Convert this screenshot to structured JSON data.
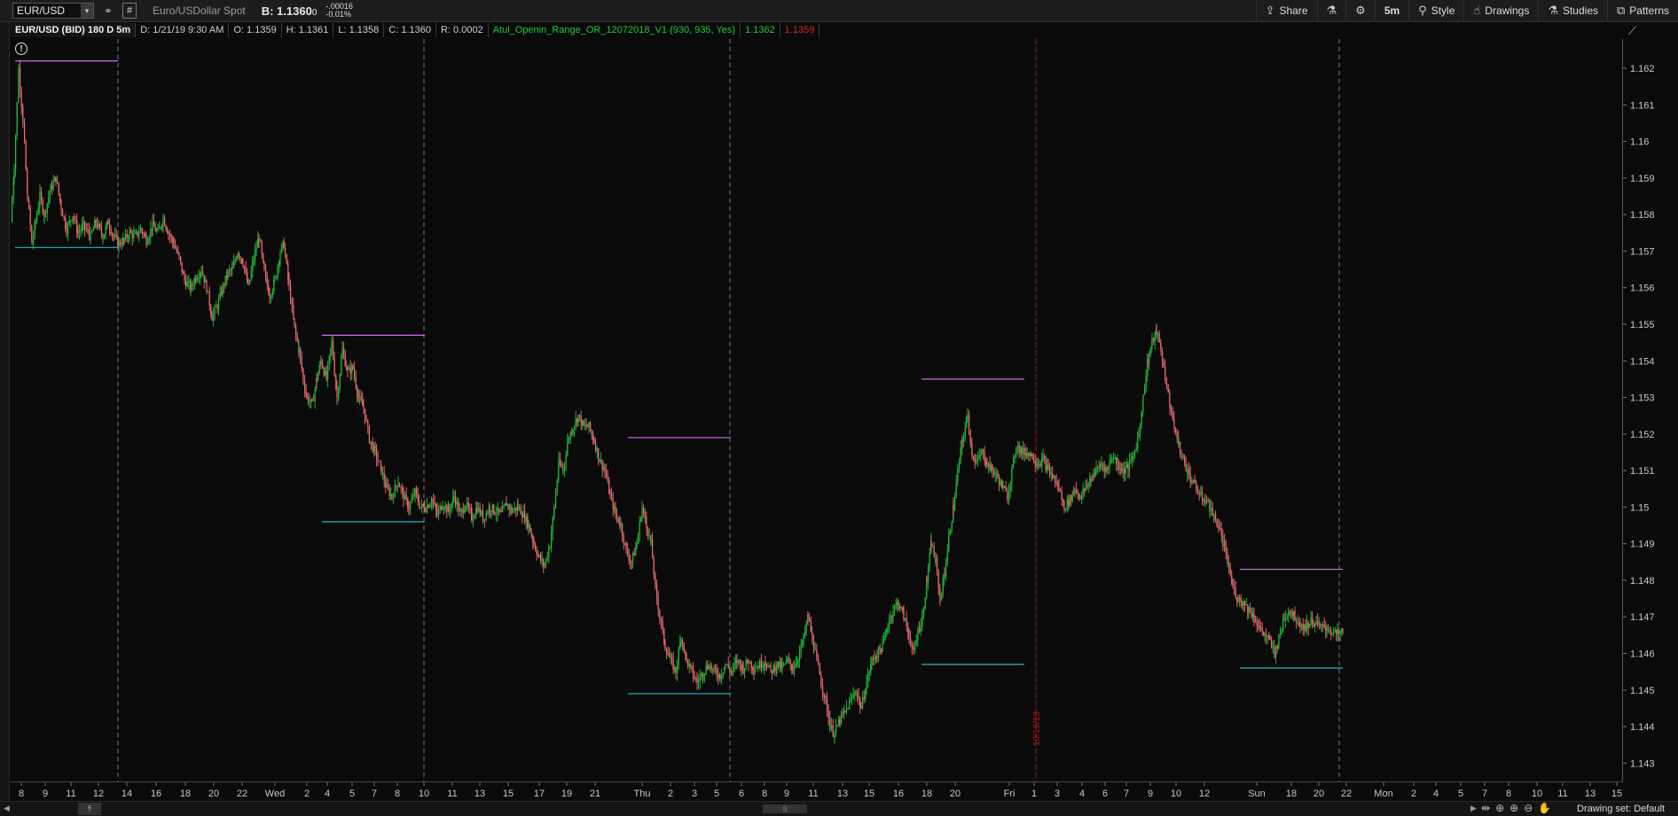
{
  "toolbar": {
    "symbol": "EUR/USD",
    "description": "Euro/USDollar Spot",
    "bid_label": "B: 1.1360",
    "bid_small": "0",
    "change_abs": "-.00016",
    "change_pct": "-0.01%",
    "share": "Share",
    "timeframe": "5m",
    "style": "Style",
    "drawings": "Drawings",
    "studies": "Studies",
    "patterns": "Patterns"
  },
  "info": {
    "title": "EUR/USD (BID) 180 D 5m",
    "date": "D: 1/21/19 9:30 AM",
    "open": "O: 1.1359",
    "high": "H: 1.1361",
    "low": "L: 1.1358",
    "close": "C: 1.1360",
    "range": "R: 0.0002",
    "study": "Atul_Openin_Range_OR_12072018_V1 (930, 935, Yes)",
    "study_high": "1.1362",
    "study_low": "1.1359"
  },
  "colors": {
    "up": "#1fc33a",
    "down": "#f07070",
    "or_high": "#d36bf0",
    "or_low": "#1fb8c8",
    "session": "#777777",
    "expiry": "#b01515"
  },
  "chart_data": {
    "type": "candlestick",
    "ylim": [
      1.1425,
      1.1628
    ],
    "y_ticks": [
      "1.162",
      "1.161",
      "1.16",
      "1.159",
      "1.158",
      "1.157",
      "1.156",
      "1.155",
      "1.154",
      "1.153",
      "1.152",
      "1.151",
      "1.15",
      "1.149",
      "1.148",
      "1.147",
      "1.146",
      "1.145",
      "1.144",
      "1.143"
    ],
    "y_tick_values": [
      1.162,
      1.161,
      1.16,
      1.159,
      1.158,
      1.157,
      1.156,
      1.155,
      1.154,
      1.153,
      1.152,
      1.151,
      1.15,
      1.149,
      1.148,
      1.147,
      1.146,
      1.145,
      1.144,
      1.143
    ],
    "x_labels": [
      "8",
      "9",
      "11",
      "12",
      "14",
      "16",
      "18",
      "20",
      "22",
      "Wed",
      "2",
      "4",
      "5",
      "7",
      "8",
      "10",
      "11",
      "13",
      "15",
      "17",
      "19",
      "21",
      "Thu",
      "2",
      "3",
      "5",
      "6",
      "8",
      "9",
      "11",
      "13",
      "15",
      "16",
      "18",
      "20",
      "Fri",
      "1",
      "3",
      "4",
      "6",
      "7",
      "9",
      "10",
      "12",
      "Sun",
      "18",
      "20",
      "22",
      "Mon",
      "2",
      "4",
      "5",
      "7",
      "8",
      "10",
      "11",
      "13",
      "15"
    ],
    "x_label_pos": [
      24,
      51,
      80,
      111,
      143,
      176,
      209,
      241,
      273,
      310,
      346,
      369,
      397,
      422,
      448,
      478,
      510,
      541,
      573,
      608,
      639,
      671,
      724,
      756,
      783,
      808,
      836,
      862,
      887,
      917,
      950,
      980,
      1013,
      1045,
      1077,
      1138,
      1166,
      1192,
      1220,
      1246,
      1270,
      1297,
      1326,
      1358,
      1417,
      1456,
      1487,
      1518,
      1560,
      1594,
      1619,
      1647,
      1674,
      1701,
      1733,
      1762,
      1793,
      1823
    ],
    "price_path": [
      [
        0,
        1.1578
      ],
      [
        4,
        1.1593
      ],
      [
        9,
        1.162
      ],
      [
        14,
        1.1605
      ],
      [
        19,
        1.1585
      ],
      [
        24,
        1.1572
      ],
      [
        28,
        1.1578
      ],
      [
        33,
        1.1585
      ],
      [
        38,
        1.158
      ],
      [
        45,
        1.1587
      ],
      [
        51,
        1.159
      ],
      [
        57,
        1.1582
      ],
      [
        63,
        1.1576
      ],
      [
        70,
        1.158
      ],
      [
        76,
        1.1575
      ],
      [
        82,
        1.1577
      ],
      [
        90,
        1.1574
      ],
      [
        96,
        1.1578
      ],
      [
        104,
        1.1574
      ],
      [
        110,
        1.1578
      ],
      [
        116,
        1.1574
      ],
      [
        122,
        1.1572
      ],
      [
        128,
        1.1573
      ],
      [
        134,
        1.1575
      ],
      [
        140,
        1.1574
      ],
      [
        147,
        1.1576
      ],
      [
        153,
        1.1573
      ],
      [
        160,
        1.1577
      ],
      [
        166,
        1.1575
      ],
      [
        172,
        1.1579
      ],
      [
        178,
        1.1575
      ],
      [
        184,
        1.1572
      ],
      [
        190,
        1.1568
      ],
      [
        196,
        1.1562
      ],
      [
        203,
        1.156
      ],
      [
        209,
        1.1563
      ],
      [
        215,
        1.1565
      ],
      [
        221,
        1.156
      ],
      [
        227,
        1.1552
      ],
      [
        233,
        1.1555
      ],
      [
        239,
        1.156
      ],
      [
        245,
        1.1564
      ],
      [
        250,
        1.1565
      ],
      [
        256,
        1.157
      ],
      [
        262,
        1.1567
      ],
      [
        268,
        1.156
      ],
      [
        274,
        1.1568
      ],
      [
        280,
        1.1574
      ],
      [
        286,
        1.1564
      ],
      [
        292,
        1.1558
      ],
      [
        298,
        1.1562
      ],
      [
        304,
        1.157
      ],
      [
        308,
        1.1572
      ],
      [
        314,
        1.156
      ],
      [
        320,
        1.1549
      ],
      [
        325,
        1.1543
      ],
      [
        330,
        1.1535
      ],
      [
        334,
        1.153
      ],
      [
        340,
        1.1528
      ],
      [
        345,
        1.1535
      ],
      [
        350,
        1.154
      ],
      [
        356,
        1.1535
      ],
      [
        362,
        1.1545
      ],
      [
        368,
        1.153
      ],
      [
        374,
        1.1543
      ],
      [
        380,
        1.1537
      ],
      [
        386,
        1.1538
      ],
      [
        392,
        1.153
      ],
      [
        398,
        1.1527
      ],
      [
        405,
        1.1518
      ],
      [
        411,
        1.1515
      ],
      [
        418,
        1.151
      ],
      [
        424,
        1.1505
      ],
      [
        430,
        1.1503
      ],
      [
        437,
        1.1507
      ],
      [
        443,
        1.1503
      ],
      [
        449,
        1.15
      ],
      [
        456,
        1.1504
      ],
      [
        462,
        1.15
      ],
      [
        468,
        1.15
      ],
      [
        475,
        1.1502
      ],
      [
        481,
        1.1498
      ],
      [
        487,
        1.1501
      ],
      [
        494,
        1.1499
      ],
      [
        500,
        1.1503
      ],
      [
        507,
        1.1498
      ],
      [
        513,
        1.1501
      ],
      [
        520,
        1.1497
      ],
      [
        526,
        1.15
      ],
      [
        533,
        1.1497
      ],
      [
        540,
        1.15
      ],
      [
        546,
        1.1499
      ],
      [
        553,
        1.1498
      ],
      [
        559,
        1.1501
      ],
      [
        565,
        1.1499
      ],
      [
        572,
        1.15
      ],
      [
        578,
        1.1498
      ],
      [
        584,
        1.1495
      ],
      [
        590,
        1.149
      ],
      [
        596,
        1.1486
      ],
      [
        602,
        1.1484
      ],
      [
        608,
        1.149
      ],
      [
        613,
        1.15
      ],
      [
        618,
        1.1512
      ],
      [
        623,
        1.151
      ],
      [
        628,
        1.1518
      ],
      [
        634,
        1.1522
      ],
      [
        640,
        1.1525
      ],
      [
        646,
        1.1522
      ],
      [
        652,
        1.1522
      ],
      [
        658,
        1.1518
      ],
      [
        664,
        1.1513
      ],
      [
        670,
        1.151
      ],
      [
        676,
        1.1503
      ],
      [
        682,
        1.1498
      ],
      [
        688,
        1.1495
      ],
      [
        694,
        1.1488
      ],
      [
        700,
        1.1485
      ],
      [
        706,
        1.149
      ],
      [
        712,
        1.15
      ],
      [
        717,
        1.1495
      ],
      [
        722,
        1.149
      ],
      [
        727,
        1.1478
      ],
      [
        732,
        1.147
      ],
      [
        738,
        1.1462
      ],
      [
        744,
        1.1458
      ],
      [
        750,
        1.1455
      ],
      [
        756,
        1.1465
      ],
      [
        762,
        1.1458
      ],
      [
        768,
        1.1455
      ],
      [
        774,
        1.1452
      ],
      [
        781,
        1.1455
      ],
      [
        787,
        1.1457
      ],
      [
        793,
        1.1455
      ],
      [
        800,
        1.1454
      ],
      [
        806,
        1.1457
      ],
      [
        813,
        1.1455
      ],
      [
        819,
        1.1458
      ],
      [
        826,
        1.1456
      ],
      [
        832,
        1.1458
      ],
      [
        838,
        1.1456
      ],
      [
        845,
        1.1457
      ],
      [
        851,
        1.1458
      ],
      [
        857,
        1.1455
      ],
      [
        864,
        1.1457
      ],
      [
        870,
        1.1456
      ],
      [
        876,
        1.1458
      ],
      [
        882,
        1.1456
      ],
      [
        888,
        1.1459
      ],
      [
        894,
        1.1464
      ],
      [
        899,
        1.147
      ],
      [
        904,
        1.1464
      ],
      [
        909,
        1.1458
      ],
      [
        914,
        1.1452
      ],
      [
        919,
        1.1447
      ],
      [
        924,
        1.144
      ],
      [
        929,
        1.1438
      ],
      [
        935,
        1.1442
      ],
      [
        941,
        1.1444
      ],
      [
        947,
        1.1447
      ],
      [
        953,
        1.145
      ],
      [
        959,
        1.1445
      ],
      [
        965,
        1.1452
      ],
      [
        971,
        1.1458
      ],
      [
        977,
        1.146
      ],
      [
        983,
        1.1462
      ],
      [
        989,
        1.1468
      ],
      [
        995,
        1.1472
      ],
      [
        1001,
        1.1474
      ],
      [
        1007,
        1.147
      ],
      [
        1013,
        1.1465
      ],
      [
        1018,
        1.146
      ],
      [
        1023,
        1.1466
      ],
      [
        1028,
        1.147
      ],
      [
        1033,
        1.148
      ],
      [
        1038,
        1.149
      ],
      [
        1043,
        1.1485
      ],
      [
        1048,
        1.1475
      ],
      [
        1053,
        1.1482
      ],
      [
        1058,
        1.1492
      ],
      [
        1063,
        1.15
      ],
      [
        1068,
        1.151
      ],
      [
        1073,
        1.1518
      ],
      [
        1079,
        1.1525
      ],
      [
        1084,
        1.1515
      ],
      [
        1089,
        1.1512
      ],
      [
        1095,
        1.1515
      ],
      [
        1101,
        1.1512
      ],
      [
        1107,
        1.151
      ],
      [
        1113,
        1.1508
      ],
      [
        1119,
        1.1505
      ],
      [
        1124,
        1.1503
      ],
      [
        1129,
        1.151
      ],
      [
        1134,
        1.1517
      ],
      [
        1140,
        1.1515
      ],
      [
        1146,
        1.1515
      ],
      [
        1152,
        1.1514
      ],
      [
        1158,
        1.1512
      ],
      [
        1164,
        1.1513
      ],
      [
        1170,
        1.151
      ],
      [
        1176,
        1.1508
      ],
      [
        1182,
        1.1505
      ],
      [
        1188,
        1.15
      ],
      [
        1194,
        1.1502
      ],
      [
        1200,
        1.1505
      ],
      [
        1206,
        1.1503
      ],
      [
        1212,
        1.1505
      ],
      [
        1218,
        1.1508
      ],
      [
        1224,
        1.151
      ],
      [
        1230,
        1.1512
      ],
      [
        1236,
        1.151
      ],
      [
        1242,
        1.1514
      ],
      [
        1248,
        1.1512
      ],
      [
        1254,
        1.151
      ],
      [
        1260,
        1.1511
      ],
      [
        1266,
        1.1514
      ],
      [
        1272,
        1.152
      ],
      [
        1277,
        1.153
      ],
      [
        1282,
        1.154
      ],
      [
        1287,
        1.1545
      ],
      [
        1292,
        1.1548
      ],
      [
        1297,
        1.1543
      ],
      [
        1302,
        1.1535
      ],
      [
        1307,
        1.1528
      ],
      [
        1312,
        1.1522
      ],
      [
        1317,
        1.1517
      ],
      [
        1322,
        1.1513
      ],
      [
        1327,
        1.151
      ],
      [
        1332,
        1.1507
      ],
      [
        1337,
        1.1505
      ],
      [
        1342,
        1.1503
      ],
      [
        1347,
        1.1502
      ],
      [
        1352,
        1.15
      ],
      [
        1357,
        1.1497
      ],
      [
        1362,
        1.1495
      ],
      [
        1367,
        1.149
      ],
      [
        1372,
        1.1485
      ],
      [
        1378,
        1.1478
      ],
      [
        1384,
        1.1475
      ],
      [
        1390,
        1.1474
      ],
      [
        1396,
        1.1472
      ],
      [
        1402,
        1.147
      ],
      [
        1408,
        1.1467
      ],
      [
        1414,
        1.1465
      ],
      [
        1420,
        1.1463
      ],
      [
        1425,
        1.146
      ],
      [
        1430,
        1.1464
      ],
      [
        1436,
        1.147
      ],
      [
        1442,
        1.1472
      ],
      [
        1448,
        1.147
      ],
      [
        1454,
        1.1468
      ],
      [
        1460,
        1.1467
      ],
      [
        1466,
        1.1469
      ],
      [
        1472,
        1.1468
      ],
      [
        1478,
        1.1467
      ],
      [
        1484,
        1.1467
      ],
      [
        1490,
        1.1466
      ],
      [
        1496,
        1.1465
      ],
      [
        1502,
        1.1466
      ]
    ],
    "opening_ranges": [
      {
        "x1": 5,
        "x2": 121,
        "high": 1.1622,
        "low": 1.1571
      },
      {
        "x1": 351,
        "x2": 467,
        "high": 1.1547,
        "low": 1.1496
      },
      {
        "x1": 696,
        "x2": 812,
        "high": 1.1519,
        "low": 1.1449
      },
      {
        "x1": 1027,
        "x2": 1143,
        "high": 1.1535,
        "low": 1.1457
      },
      {
        "x1": 1386,
        "x2": 1502,
        "high": 1.1483,
        "low": 1.1456
      }
    ],
    "session_lines": [
      121,
      466,
      811,
      1498
    ],
    "expiry_line": {
      "x": 1156,
      "label": "10/19/18"
    }
  },
  "footer": {
    "drawing_set": "Drawing set: Default"
  }
}
